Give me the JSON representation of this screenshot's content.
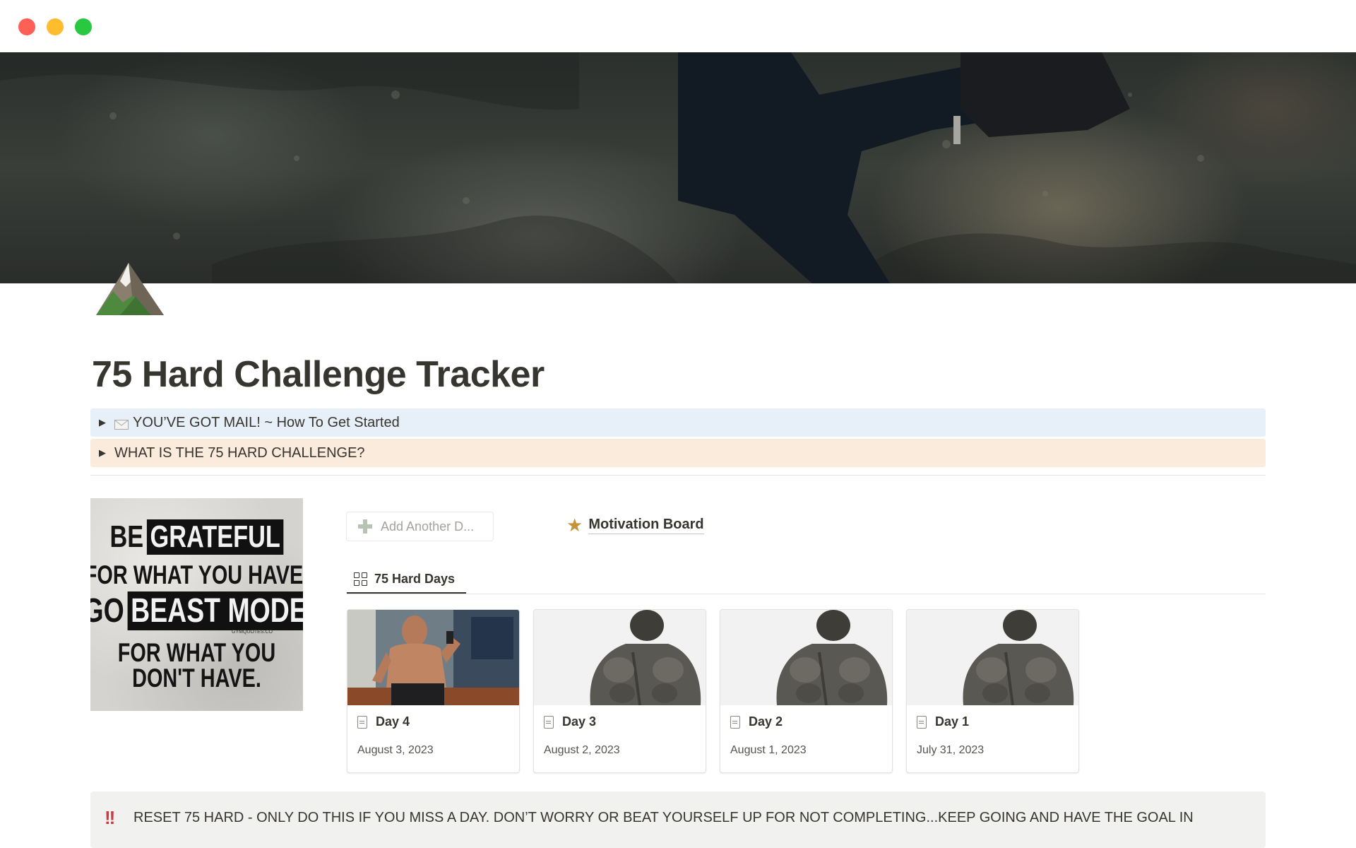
{
  "window": {
    "controls": [
      "close",
      "minimize",
      "zoom"
    ]
  },
  "page": {
    "title": "75 Hard Challenge Tracker",
    "icon": "mountain-icon"
  },
  "toggles": [
    {
      "label": "YOU’VE GOT MAIL! ~ How To Get Started",
      "icon": "envelope-icon",
      "bg": "#e7f0f8"
    },
    {
      "label": "WHAT IS THE 75 HARD CHALLENGE?",
      "bg": "#faebdd"
    }
  ],
  "poster": {
    "line1a": "BE",
    "line1b": "GRATEFUL",
    "line2": "FOR WHAT YOU HAVE.",
    "line3a": "GO",
    "line3b": "BEAST MODE",
    "line4": "FOR WHAT YOU",
    "line5": "DON'T HAVE.",
    "credit": "GYMQUOTES.CO"
  },
  "add_button": {
    "label": "Add Another D..."
  },
  "motivation_link": {
    "label": "Motivation Board",
    "icon": "star-icon",
    "color": "#c5933a"
  },
  "view_tab": {
    "label": "75 Hard Days",
    "icon": "gallery-icon"
  },
  "cards": [
    {
      "name": "Day 4",
      "date": "August 3, 2023",
      "thumb": "gym-selfie"
    },
    {
      "name": "Day 3",
      "date": "August 2, 2023",
      "thumb": "statue-back"
    },
    {
      "name": "Day 2",
      "date": "August 1, 2023",
      "thumb": "statue-back"
    },
    {
      "name": "Day 1",
      "date": "July 31, 2023",
      "thumb": "statue-back"
    }
  ],
  "callout": {
    "icon": "double-exclamation-icon",
    "text": "RESET 75 HARD - ONLY DO THIS IF YOU MISS A DAY.  DON’T WORRY OR BEAT YOURSELF UP FOR NOT COMPLETING...KEEP GOING AND HAVE THE GOAL IN"
  }
}
